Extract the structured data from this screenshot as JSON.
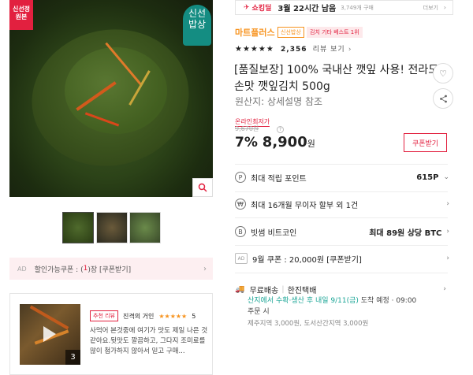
{
  "left": {
    "corner_badge": "신선정\n원본",
    "stamp": "신선\n밥상",
    "coupon": {
      "ad": "AD",
      "pre": "할인가능쿠폰 : (",
      "count": "1",
      "post": ")장 [쿠폰받기]"
    },
    "review": {
      "tag": "추천 리뷰",
      "author": "진격의 거인",
      "rating": "5",
      "text": "사먹어 본것중에 여기가 맛도 제일 나은 것 같아요.뒷맛도 깔끔하고, 그다지 조미료를 많이 첨가하지 않아서 믿고 구매...",
      "count": "3"
    }
  },
  "right": {
    "topbar": {
      "deal": "쇼킹딜",
      "time": "3월 22시간 남음",
      "sold": "3,749개 구매",
      "more": "더보기"
    },
    "brand": "마트플러스",
    "tag_fresh": "신선밥상",
    "tag_best": "김치 기타 베스트 1위",
    "stars": "★★★★★",
    "review_count": "2,356",
    "review_link": "리뷰 보기",
    "title": "[품질보장] 100% 국내산 깻잎 사용! 전라도 손맛 깻잎김치 500g",
    "origin": "원산지: 상세설명 참조",
    "online_price_label": "온라인최저가",
    "original_price": "9,670원",
    "discount": "7%",
    "price": "8,900",
    "won": "원",
    "coupon_btn": "쿠폰받기",
    "rows": [
      {
        "icon": "P",
        "label": "최대 적립 포인트",
        "value": "615P",
        "arrow": "⌄"
      },
      {
        "icon": "₩",
        "label": "최대 16개월 무이자 할부 외 1건",
        "value": "",
        "arrow": "›"
      },
      {
        "icon": "B",
        "label": "빗썸 비트코인",
        "value": "최대 89원 상당 BTC",
        "arrow": "›"
      },
      {
        "icon": "AD",
        "label": "9월 쿠폰 : 20,000원 [쿠폰받기]",
        "value": "",
        "arrow": "›"
      }
    ],
    "shipping": {
      "free": "무료배송",
      "carrier": "한진택배",
      "line1_green": "산지에서 수확·생산 후 내일 9/11(금)",
      "line1_rest": " 도착 예정 · 09:00",
      "line2": "주문 시",
      "line3": "제주지역 3,000원, 도서산간지역 3,000원"
    }
  }
}
